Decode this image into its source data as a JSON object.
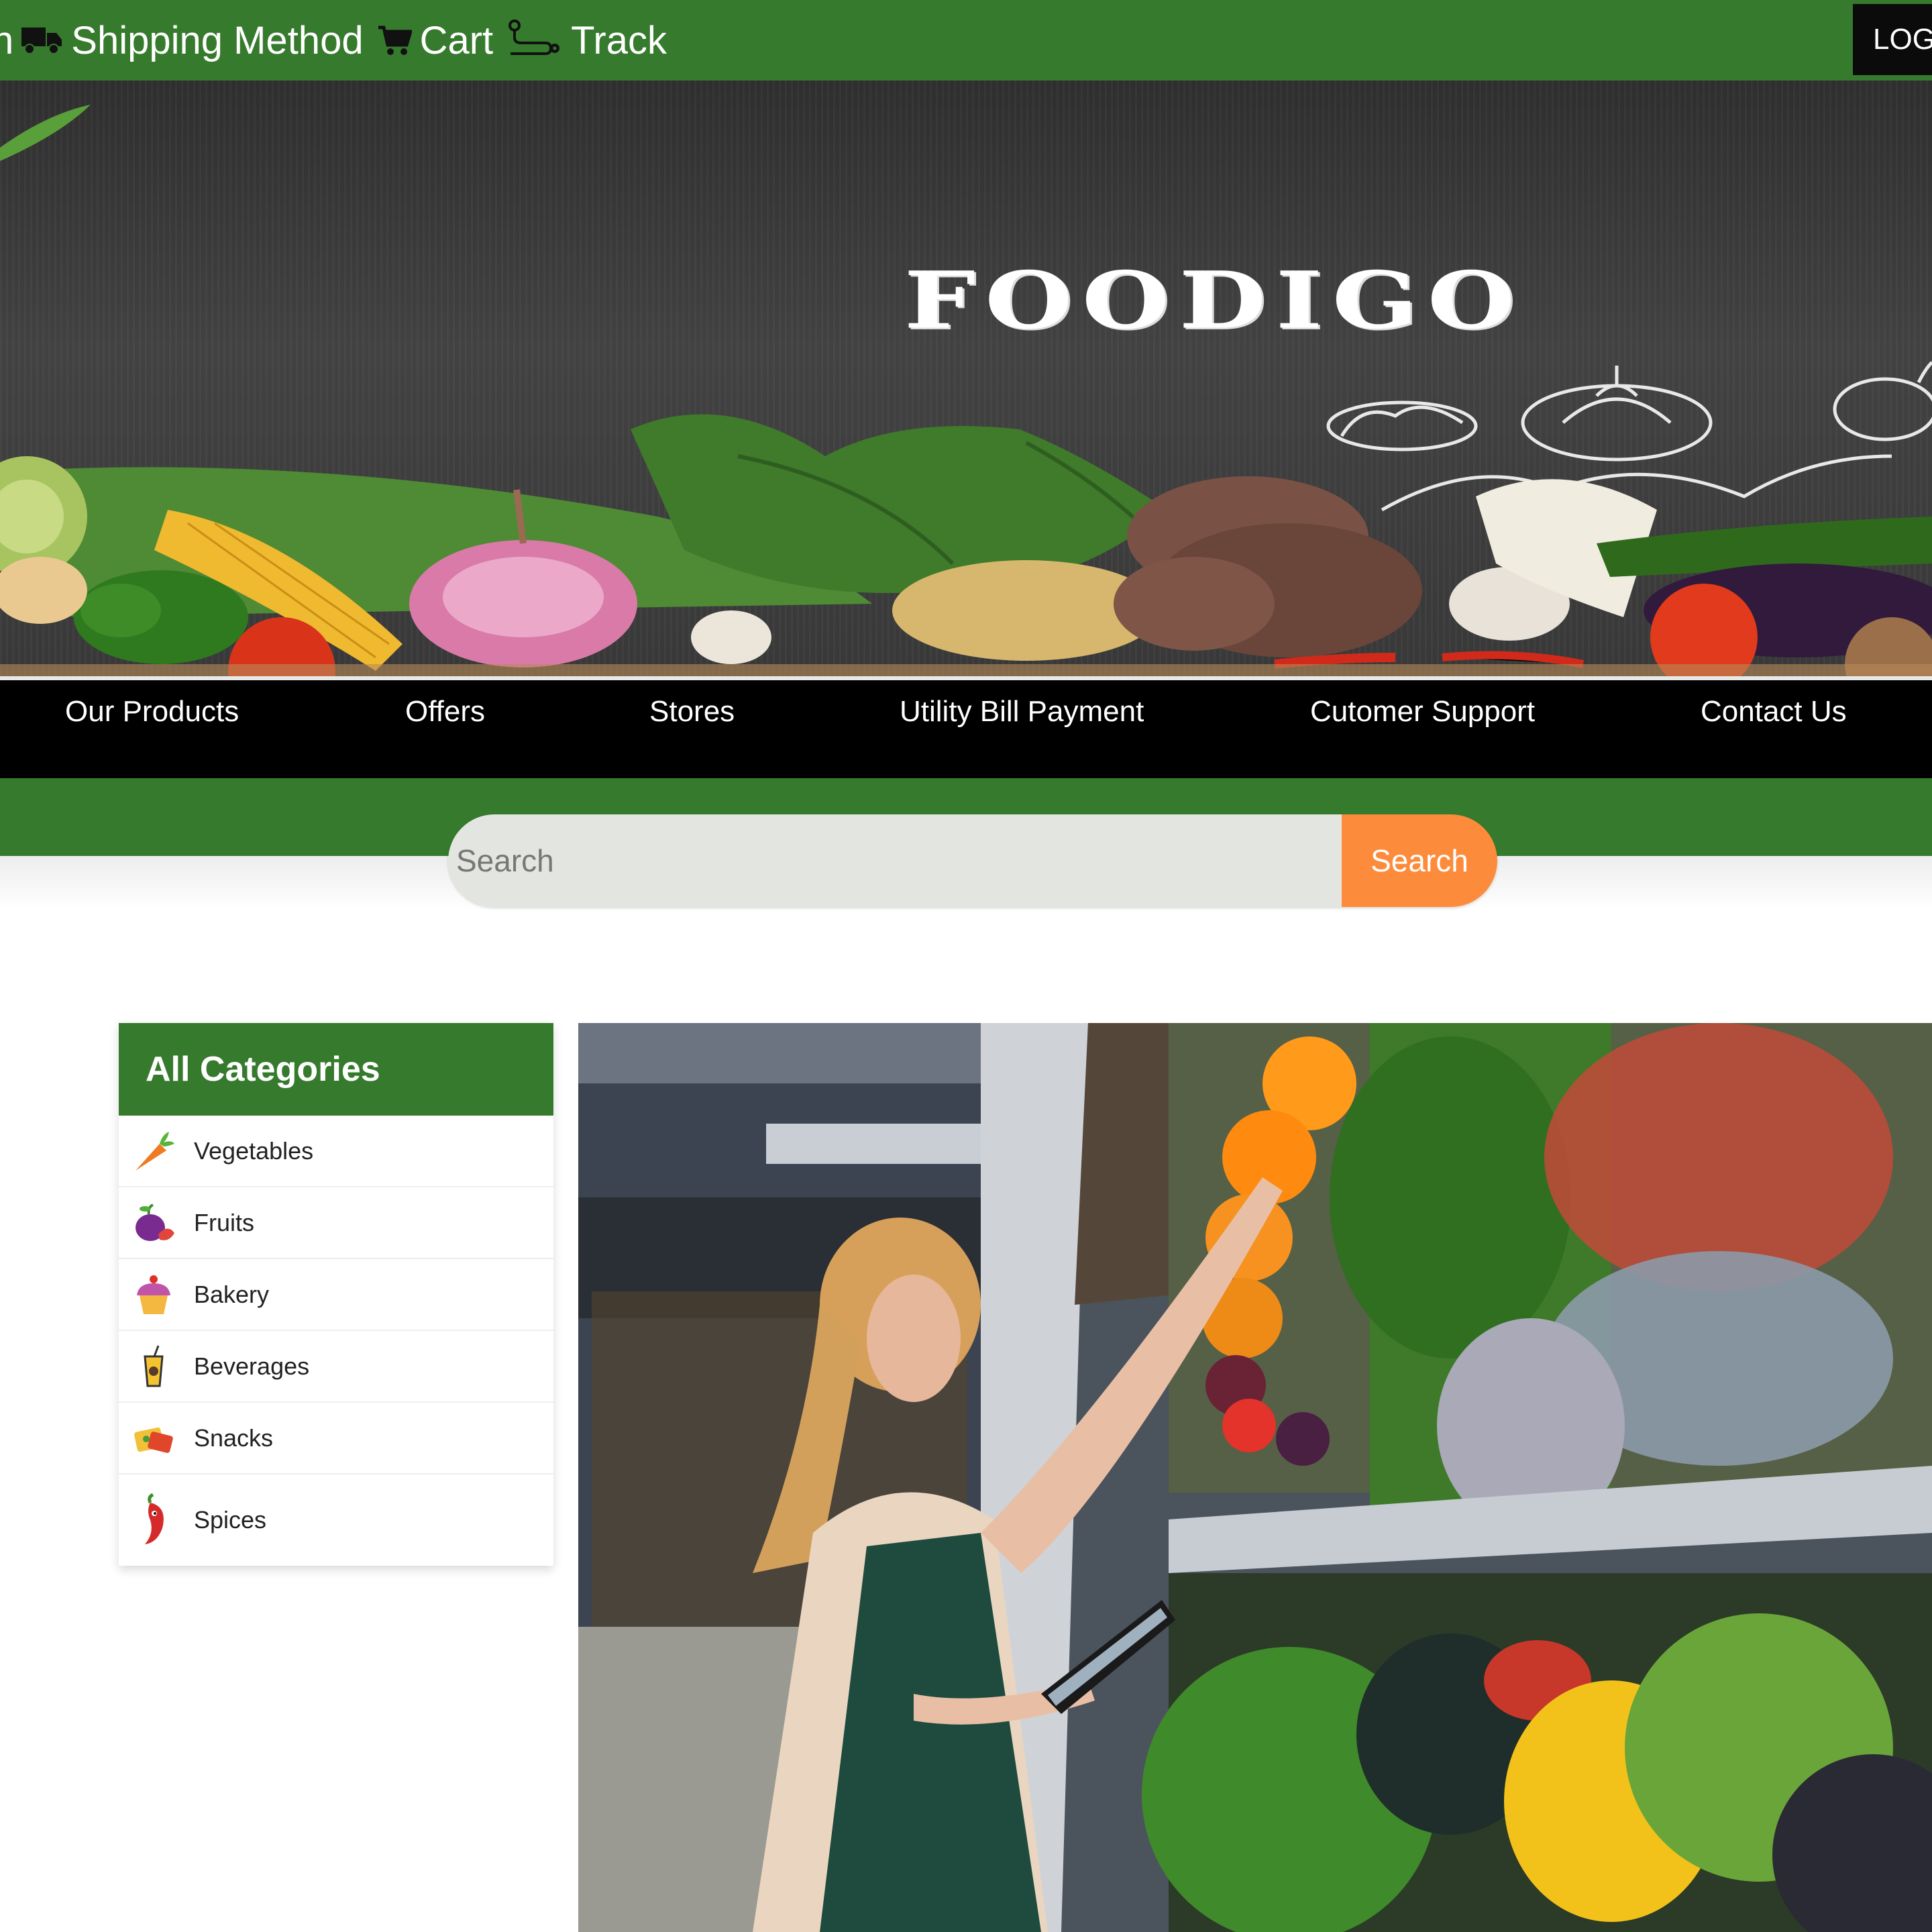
{
  "topnav": {
    "items": [
      {
        "label": "n",
        "icon": "none"
      },
      {
        "label": "Shipping Method",
        "icon": "truck-icon"
      },
      {
        "label": "Cart",
        "icon": "cart-icon"
      },
      {
        "label": "Track",
        "icon": "route-icon"
      }
    ],
    "login_label": "LOG"
  },
  "banner": {
    "brand": "FOODIGO"
  },
  "mainnav": {
    "items": [
      "Our Products",
      "Offers",
      "Stores",
      "Utility Bill Payment",
      "Cutomer Support",
      "Contact Us"
    ]
  },
  "search": {
    "placeholder": "Search",
    "value": "",
    "button_label": "Search"
  },
  "categories": {
    "title": "All Categories",
    "items": [
      {
        "label": "Vegetables",
        "icon": "carrot-icon"
      },
      {
        "label": "Fruits",
        "icon": "fruit-icon"
      },
      {
        "label": "Bakery",
        "icon": "cupcake-icon"
      },
      {
        "label": "Beverages",
        "icon": "drink-icon"
      },
      {
        "label": "Snacks",
        "icon": "snacks-icon"
      },
      {
        "label": "Spices",
        "icon": "chili-icon"
      }
    ]
  },
  "colors": {
    "brand_green": "#367b2d",
    "accent_orange": "#fd8b3c",
    "nav_black": "#000000"
  }
}
